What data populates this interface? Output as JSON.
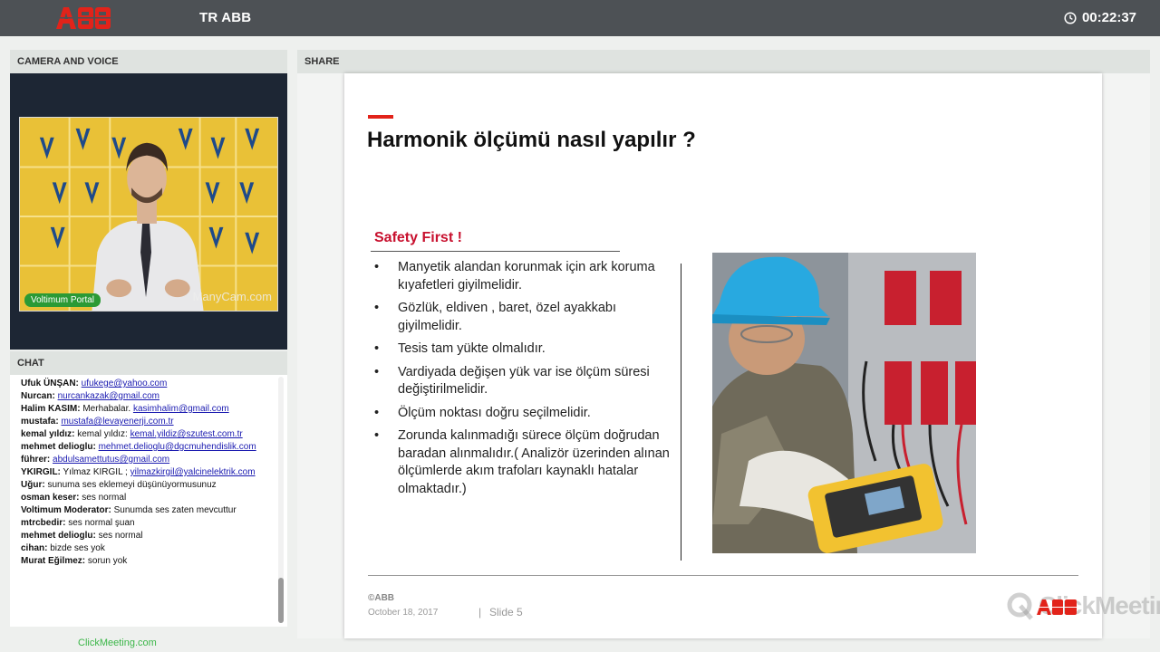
{
  "topbar": {
    "title": "TR ABB",
    "timer": "00:22:37",
    "logo_icon": "abb-logo",
    "clock_icon": "clock-icon",
    "brand_color": "#e2231a"
  },
  "camera": {
    "header": "CAMERA AND VOICE",
    "presenter_badge": "Voltimum Portal",
    "watermark": "ManyCam.com"
  },
  "chat": {
    "header": "CHAT",
    "messages": [
      {
        "user": "Ufuk ÜNŞAN:",
        "text": "",
        "link": "ufukege@yahoo.com"
      },
      {
        "user": "Nurcan:",
        "text": "",
        "link": "nurcankazak@gmail.com"
      },
      {
        "user": "Halim KASIM:",
        "text": "Merhabalar.",
        "link": "kasimhalim@gmail.com"
      },
      {
        "user": "mustafa:",
        "text": "",
        "link": "mustafa@levayenerji.com.tr"
      },
      {
        "user": "kemal yıldız:",
        "text": "kemal yıldız:",
        "link": "kemal.yildiz@szutest.com.tr"
      },
      {
        "user": "mehmet delioglu:",
        "text": "",
        "link": "mehmet.delioglu@dgcmuhendislik.com"
      },
      {
        "user": "führer:",
        "text": "",
        "link": "abdulsamettutus@gmail.com"
      },
      {
        "user": "YKIRGIL:",
        "text": "Yılmaz KIRGIL ;",
        "link": "yilmazkirgil@yalcinelektrik.com"
      },
      {
        "user": "Uğur:",
        "text": "sunuma ses eklemeyi düşünüyormusunuz",
        "link": ""
      },
      {
        "user": "osman keser:",
        "text": "ses normal",
        "link": ""
      },
      {
        "user": "Voltimum Moderator:",
        "text": "Sunumda ses zaten mevcuttur",
        "link": ""
      },
      {
        "user": "mtrcbedir:",
        "text": "ses normal şuan",
        "link": ""
      },
      {
        "user": "mehmet delioglu:",
        "text": "ses normal",
        "link": ""
      },
      {
        "user": "cihan:",
        "text": "bizde ses yok",
        "link": ""
      },
      {
        "user": "Murat Eğilmez:",
        "text": "sorun yok",
        "link": ""
      }
    ]
  },
  "footer": {
    "brand": "ClickMeeting.com"
  },
  "share": {
    "header": "SHARE",
    "watermark": "ClickMeeting",
    "slide": {
      "title": "Harmonik ölçümü nasıl yapılır ?",
      "subtitle": "Safety First !",
      "bullets": [
        "Manyetik alandan korunmak için ark koruma kıyafetleri giyilmelidir.",
        "Gözlük, eldiven , baret, özel ayakkabı giyilmelidir.",
        "Tesis tam yükte olmalıdır.",
        "Vardiyada değişen yük var ise ölçüm süresi değiştirilmelidir.",
        "Ölçüm noktası doğru seçilmelidir.",
        "Zorunda kalınmadığı sürece  ölçüm doğrudan baradan alınmalıdır.( Analizör üzerinden alınan ölçümlerde akım trafoları kaynaklı  hatalar olmaktadır.)"
      ],
      "copyright": "©ABB",
      "date": "October 18, 2017",
      "separator": "|",
      "slide_number": "Slide 5"
    }
  }
}
